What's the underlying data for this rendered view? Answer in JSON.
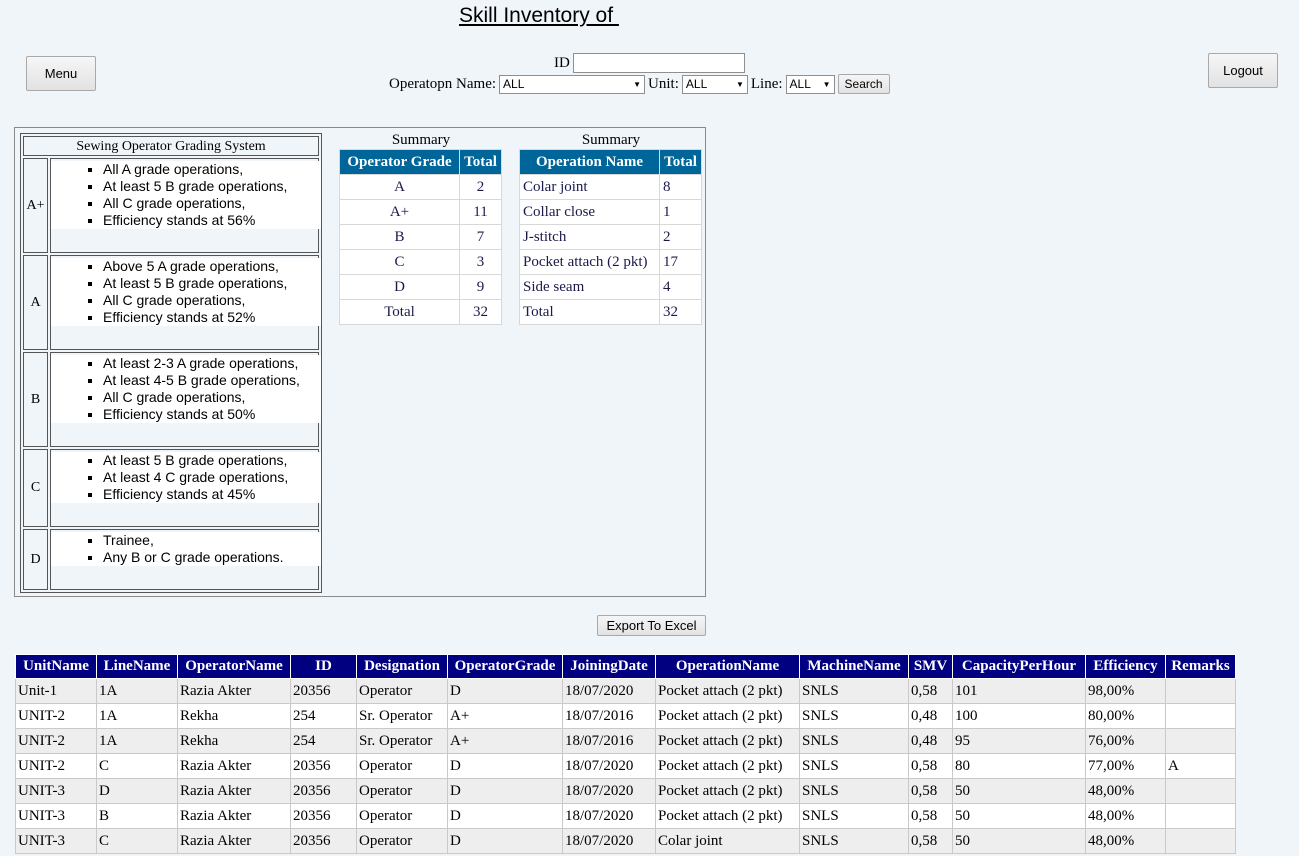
{
  "header": {
    "title": "Skill Inventory of ",
    "menu_label": "Menu",
    "logout_label": "Logout",
    "id_label": "ID",
    "id_value": "",
    "operation_label": "Operatopn Name:",
    "operation_value": "ALL",
    "unit_label": "Unit:",
    "unit_value": "ALL",
    "line_label": "Line:",
    "line_value": "ALL",
    "search_label": "Search"
  },
  "grading": {
    "title": "Sewing Operator Grading System",
    "grades": [
      {
        "key": "A+",
        "items": [
          "All A grade operations,",
          "At least 5 B grade operations,",
          "All C grade operations,",
          "Efficiency stands at 56%"
        ]
      },
      {
        "key": "A",
        "items": [
          "Above 5 A grade operations,",
          "At least 5 B grade operations,",
          "All C grade operations,",
          "Efficiency stands at 52%"
        ]
      },
      {
        "key": "B",
        "items": [
          "At least 2-3 A grade operations,",
          "At least 4-5 B grade operations,",
          "All C grade operations,",
          "Efficiency stands at 50%"
        ]
      },
      {
        "key": "C",
        "items": [
          "At least 5 B grade operations,",
          "At least 4 C grade operations,",
          "Efficiency stands at 45%"
        ]
      },
      {
        "key": "D",
        "items": [
          "Trainee,",
          "Any B or C grade operations."
        ]
      }
    ]
  },
  "grade_summary": {
    "caption": "Summary",
    "headers": [
      "Operator Grade",
      "Total"
    ],
    "rows": [
      [
        "A",
        "2"
      ],
      [
        "A+",
        "11"
      ],
      [
        "B",
        "7"
      ],
      [
        "C",
        "3"
      ],
      [
        "D",
        "9"
      ],
      [
        "Total",
        "32"
      ]
    ]
  },
  "operation_summary": {
    "caption": "Summary",
    "headers": [
      "Operation Name",
      "Total"
    ],
    "rows": [
      [
        "Colar joint",
        "8"
      ],
      [
        "Collar close",
        "1"
      ],
      [
        "J-stitch",
        "2"
      ],
      [
        "Pocket attach (2 pkt)",
        "17"
      ],
      [
        "Side seam",
        "4"
      ],
      [
        "Total",
        "32"
      ]
    ]
  },
  "export_label": "Export To Excel",
  "table": {
    "headers": [
      "UnitName",
      "LineName",
      "OperatorName",
      "ID",
      "Designation",
      "OperatorGrade",
      "JoiningDate",
      "OperationName",
      "MachineName",
      "SMV",
      "CapacityPerHour",
      "Efficiency",
      "Remarks"
    ],
    "rows": [
      [
        "Unit-1",
        "1A",
        "Razia Akter",
        "20356",
        "Operator",
        "D",
        "18/07/2020",
        "Pocket attach (2 pkt)",
        "SNLS",
        "0,58",
        "101",
        "98,00%",
        ""
      ],
      [
        "UNIT-2",
        "1A",
        "Rekha",
        "254",
        "Sr. Operator",
        "A+",
        "18/07/2016",
        "Pocket attach (2 pkt)",
        "SNLS",
        "0,48",
        "100",
        "80,00%",
        ""
      ],
      [
        "UNIT-2",
        "1A",
        "Rekha",
        "254",
        "Sr. Operator",
        "A+",
        "18/07/2016",
        "Pocket attach (2 pkt)",
        "SNLS",
        "0,48",
        "95",
        "76,00%",
        ""
      ],
      [
        "UNIT-2",
        "C",
        "Razia Akter",
        "20356",
        "Operator",
        "D",
        "18/07/2020",
        "Pocket attach (2 pkt)",
        "SNLS",
        "0,58",
        "80",
        "77,00%",
        "A"
      ],
      [
        "UNIT-3",
        "D",
        "Razia Akter",
        "20356",
        "Operator",
        "D",
        "18/07/2020",
        "Pocket attach (2 pkt)",
        "SNLS",
        "0,58",
        "50",
        "48,00%",
        ""
      ],
      [
        "UNIT-3",
        "B",
        "Razia Akter",
        "20356",
        "Operator",
        "D",
        "18/07/2020",
        "Pocket attach (2 pkt)",
        "SNLS",
        "0,58",
        "50",
        "48,00%",
        ""
      ],
      [
        "UNIT-3",
        "C",
        "Razia Akter",
        "20356",
        "Operator",
        "D",
        "18/07/2020",
        "Colar joint",
        "SNLS",
        "0,58",
        "50",
        "48,00%",
        ""
      ]
    ]
  }
}
